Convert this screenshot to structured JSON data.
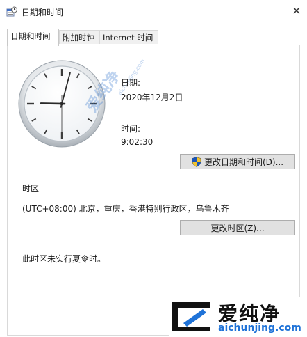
{
  "window": {
    "title": "日期和时间",
    "close_symbol": "✕"
  },
  "tabs": [
    {
      "label": "日期和时间",
      "active": true
    },
    {
      "label": "附加时钟",
      "active": false
    },
    {
      "label": "Internet 时间",
      "active": false
    }
  ],
  "clock": {
    "hours": 9,
    "minutes": 2,
    "seconds": 30
  },
  "date": {
    "label": "日期:",
    "value": "2020年12月2日"
  },
  "time": {
    "label": "时间:",
    "value": "9:02:30"
  },
  "buttons": {
    "change_datetime": "更改日期和时间(D)...",
    "change_timezone": "更改时区(Z)..."
  },
  "timezone": {
    "section_label": "时区",
    "value": "(UTC+08:00) 北京，重庆，香港特别行政区，乌鲁木齐"
  },
  "dst_note": "此时区未实行夏令时。",
  "watermark": {
    "text": "爱纯净",
    "url": "aichunjing.com"
  },
  "brand": {
    "name": "爱纯净",
    "url": "aichunjing.com"
  },
  "colors": {
    "accent_blue": "#1f73d8",
    "button_face": "#e1e1e1",
    "shield_blue": "#1a56b8",
    "shield_yellow": "#f2c32c"
  }
}
